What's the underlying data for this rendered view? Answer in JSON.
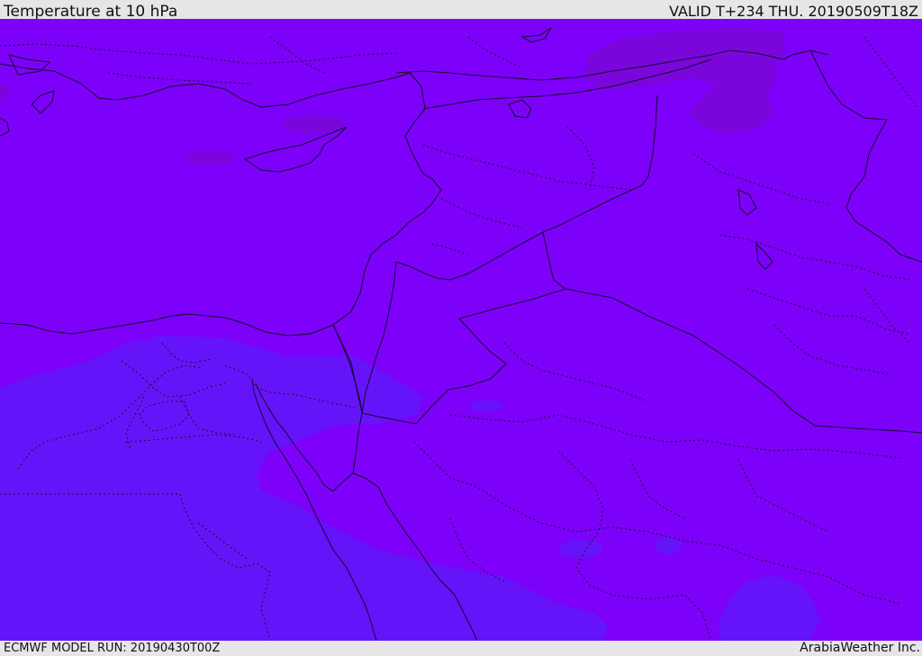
{
  "header": {
    "title": "Temperature at 10 hPa",
    "valid": "VALID T+234 THU. 20190509T18Z"
  },
  "footer": {
    "model_run": "ECMWF MODEL RUN: 20190430T00Z",
    "brand": "ArabiaWeather Inc."
  },
  "colors": {
    "main_field": "#7d00fa",
    "cool_field": "#6514fa",
    "warm_field": "#7a08e0",
    "border": "#1a1a2e",
    "bar_background": "#e6e6e6"
  }
}
